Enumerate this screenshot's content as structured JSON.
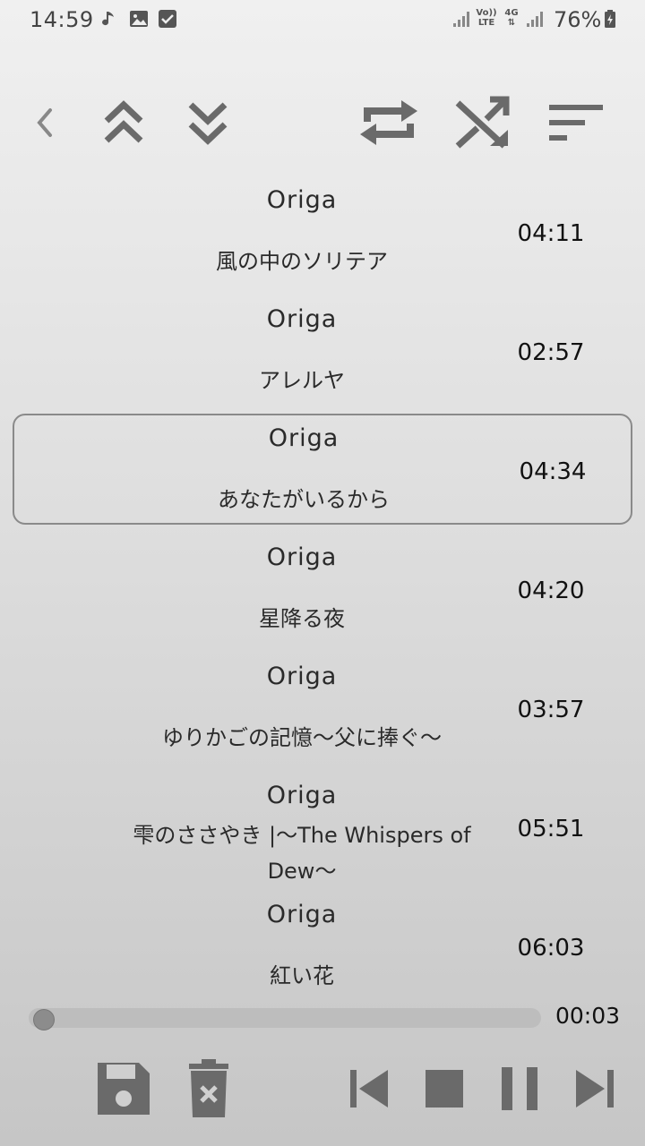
{
  "status_bar": {
    "time": "14:59",
    "battery_percent": "76%",
    "left_icons": [
      "music-note-icon",
      "image-icon",
      "checkbox-icon"
    ],
    "right_icons": [
      "signal-icon",
      "volte-icon",
      "4g-icon",
      "signal-icon",
      "battery-charging-icon"
    ],
    "volte_label": "Vo)) LTE",
    "net_label": "4G"
  },
  "toolbar": {
    "left": [
      "back-chevron-icon",
      "move-up-double-icon",
      "move-down-double-icon"
    ],
    "right": [
      "repeat-icon",
      "shuffle-icon",
      "sort-icon"
    ]
  },
  "playlist": [
    {
      "artist": "Origa",
      "title": "風の中のソリテア",
      "duration": "04:11",
      "selected": false
    },
    {
      "artist": "Origa",
      "title": "アレルヤ",
      "duration": "02:57",
      "selected": false
    },
    {
      "artist": "Origa",
      "title": "あなたがいるから",
      "duration": "04:34",
      "selected": true
    },
    {
      "artist": "Origa",
      "title": "星降る夜",
      "duration": "04:20",
      "selected": false
    },
    {
      "artist": "Origa",
      "title": "ゆりかごの記憶〜父に捧ぐ〜",
      "duration": "03:57",
      "selected": false
    },
    {
      "artist": "Origa",
      "title": "雫のささやき |〜The Whispers of Dew〜",
      "duration": "05:51",
      "selected": false
    },
    {
      "artist": "Origa",
      "title": "紅い花",
      "duration": "06:03",
      "selected": false
    }
  ],
  "playback": {
    "elapsed": "00:03",
    "progress_fraction": 0.01
  },
  "controls": [
    "save-icon",
    "delete-icon",
    "skip-previous-icon",
    "stop-icon",
    "pause-icon",
    "skip-next-icon"
  ],
  "colors": {
    "icon": "#6a6a6a",
    "selected_border": "#8a8a8a",
    "progress_track": "#bdbdbd"
  }
}
